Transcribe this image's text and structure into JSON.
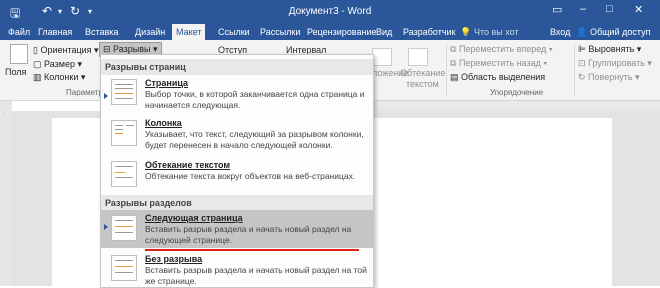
{
  "titlebar": {
    "title": "Документ3 - Word",
    "save_icon": "save-icon",
    "undo_icon": "undo-icon",
    "redo_icon": "redo-icon",
    "customize_icon": "chevron-down-icon"
  },
  "tabs": [
    {
      "label": "Файл"
    },
    {
      "label": "Главная"
    },
    {
      "label": "Вставка"
    },
    {
      "label": "Дизайн"
    },
    {
      "label": "Макет",
      "active": true
    },
    {
      "label": "Ссылки"
    },
    {
      "label": "Рассылки"
    },
    {
      "label": "Рецензирование"
    },
    {
      "label": "Вид"
    },
    {
      "label": "Разработчик"
    }
  ],
  "tellme": "Что вы хот",
  "signin": "Вход",
  "share": "Общий доступ",
  "ribbon": {
    "fields": "Поля",
    "orientation": "Ориентация",
    "size": "Размер",
    "columns": "Колонки",
    "breaks": "Разрывы",
    "indent": "Отступ",
    "spacing": "Интервал",
    "group_page_setup": "Параметр",
    "position_partial": "ложение",
    "wrap_text": "Обтекание",
    "wrap_text2": "текстом",
    "bring_forward": "Переместить вперед",
    "send_backward": "Переместить назад",
    "selection_pane": "Область выделения",
    "align": "Выровнять",
    "group": "Группировать",
    "rotate": "Повернуть",
    "group_arrange": "Упорядочение"
  },
  "dropdown": {
    "header_page_breaks": "Разрывы страниц",
    "header_section_breaks": "Разрывы разделов",
    "items": [
      {
        "title": "Страница",
        "desc": "Выбор точки, в которой заканчивается одна страница и начинается следующая."
      },
      {
        "title": "Колонка",
        "desc": "Указывает, что текст, следующий за разрывом колонки, будет перенесен в начало следующей колонки."
      },
      {
        "title": "Обтекание текстом",
        "desc": "Обтекание текста вокруг объектов на веб-страницах."
      },
      {
        "title": "Следующая страница",
        "desc": "Вставить разрыв раздела и начать новый раздел на следующей странице."
      },
      {
        "title": "Без разрыва",
        "desc": "Вставить разрыв раздела и начать новый раздел на той же странице."
      }
    ]
  },
  "colors": {
    "brand": "#2b579a",
    "highlight": "#c5c5c5",
    "underline": "#e0211a"
  }
}
